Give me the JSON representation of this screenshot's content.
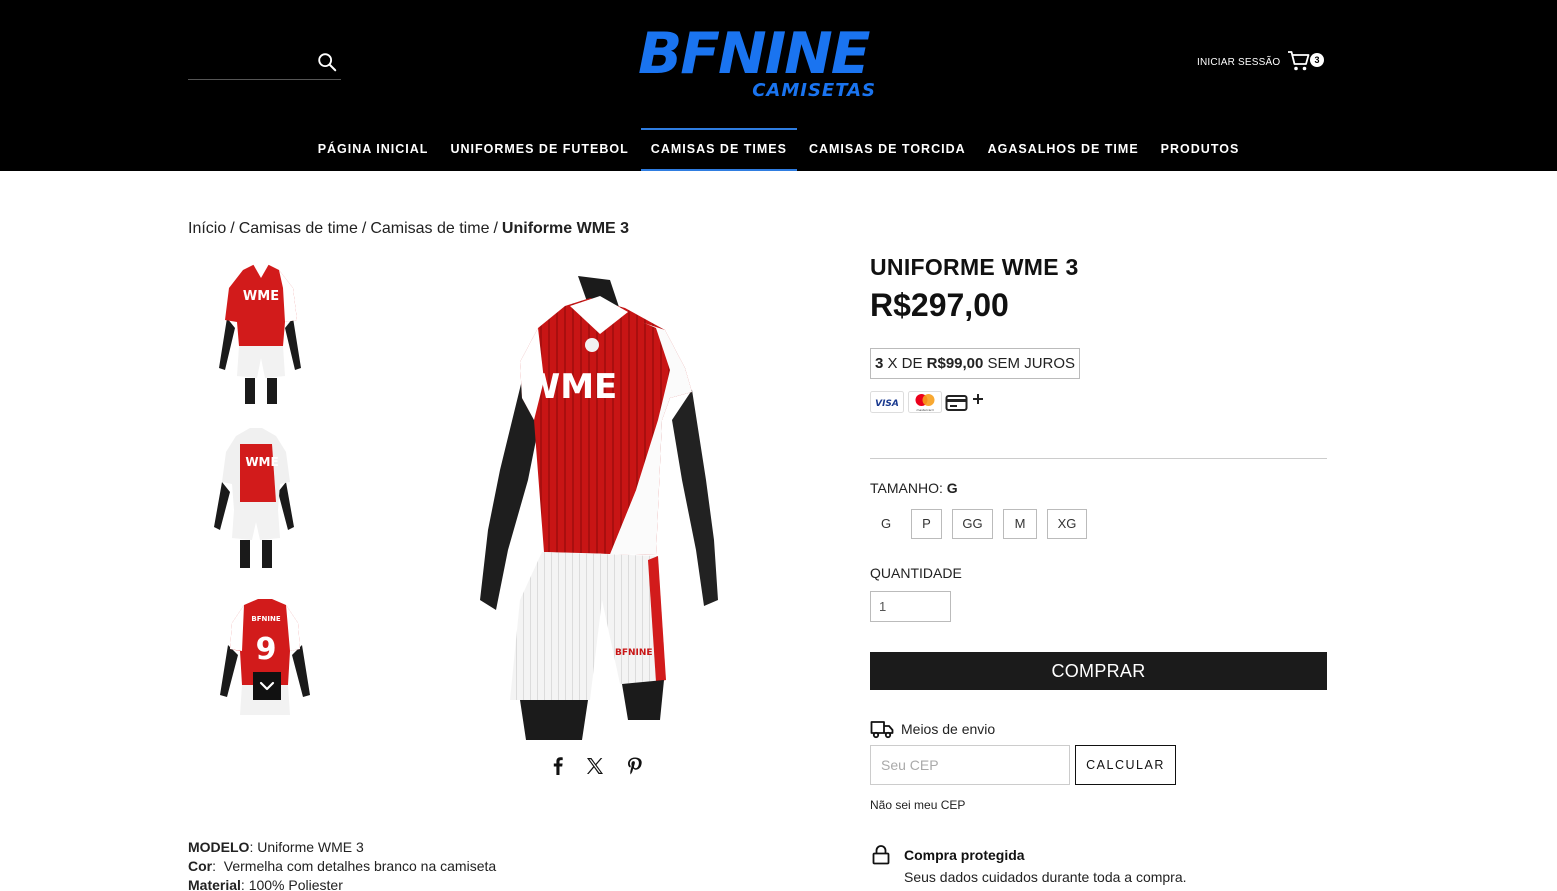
{
  "header": {
    "search_placeholder": "",
    "logo_main": "BFNINE",
    "logo_sub": "CAMISETAS",
    "login_label": "INICIAR SESSÃO",
    "cart_count": "3",
    "brand_color": "#1a74f0"
  },
  "nav": {
    "items": [
      {
        "label": "PÁGINA INICIAL"
      },
      {
        "label": "UNIFORMES DE FUTEBOL"
      },
      {
        "label": "CAMISAS DE TIMES",
        "active": true
      },
      {
        "label": "CAMISAS DE TORCIDA"
      },
      {
        "label": "AGASALHOS DE TIME"
      },
      {
        "label": "PRODUTOS"
      }
    ]
  },
  "breadcrumb": {
    "items": [
      "Início",
      "Camisas de time",
      "Camisas de time"
    ],
    "current": "Uniforme WME 3",
    "separator": "/"
  },
  "gallery": {
    "shirt_text": "WME",
    "thumb_back_text": "BFNINE",
    "thumb_back_number": "9",
    "shorts_logo": "BFNINE"
  },
  "product": {
    "title": "UNIFORME WME 3",
    "price": "R$297,00",
    "installment": {
      "count": "3",
      "prefix": " X DE ",
      "value": "R$99,00",
      "suffix": " SEM JUROS"
    },
    "payment_methods": [
      "VISA",
      "mastercard"
    ],
    "size_label": "TAMANHO: ",
    "size_selected": "G",
    "sizes": [
      "G",
      "P",
      "GG",
      "M",
      "XG"
    ],
    "qty_label": "QUANTIDADE",
    "qty_value": "1",
    "buy_label": "COMPRAR",
    "shipping": {
      "label": "Meios de envio",
      "cep_placeholder": "Seu CEP",
      "calc_label": "CALCULAR",
      "no_cep_label": "Não sei meu CEP"
    },
    "secure": {
      "title": "Compra protegida",
      "text": "Seus dados cuidados durante toda a compra."
    }
  },
  "description": {
    "model_label": "MODELO",
    "model_value": ": Uniforme WME 3",
    "color_label": "Cor",
    "color_value": ":  Vermelha com detalhes branco na camiseta",
    "material_label": "Material",
    "material_value": ": 100% Poliester"
  }
}
